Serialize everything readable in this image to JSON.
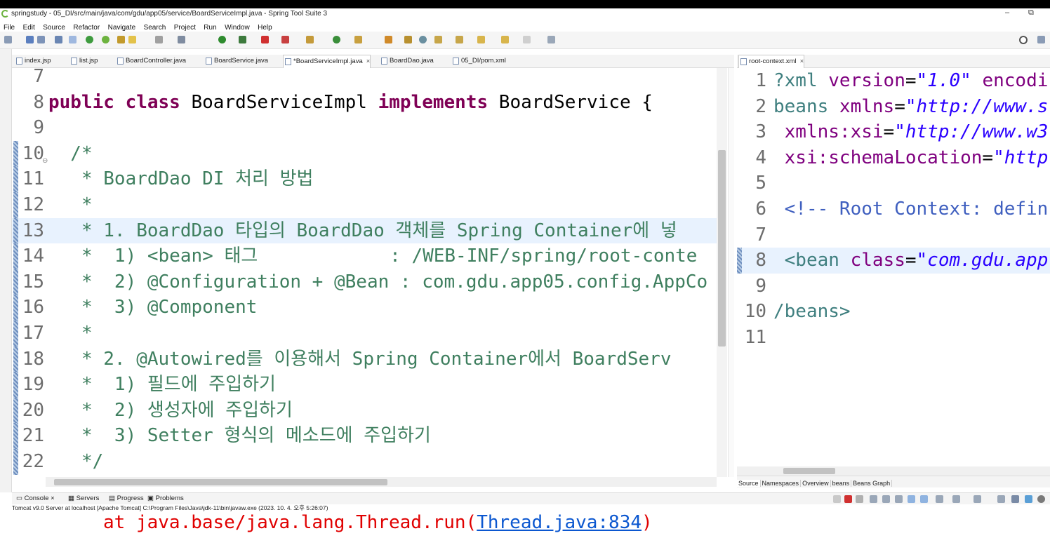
{
  "window": {
    "title": "springstudy - 05_DI/src/main/java/com/gdu/app05/service/BoardServiceImpl.java - Spring Tool Suite 3",
    "minimize": "–",
    "restore": "⧉"
  },
  "menu": [
    "File",
    "Edit",
    "Source",
    "Refactor",
    "Navigate",
    "Search",
    "Project",
    "Run",
    "Window",
    "Help"
  ],
  "editor_tabs": [
    {
      "label": "index.jsp"
    },
    {
      "label": "list.jsp"
    },
    {
      "label": "BoardController.java"
    },
    {
      "label": "BoardService.java"
    },
    {
      "label": "*BoardServiceImpl.java",
      "close": "×"
    },
    {
      "label": "BoardDao.java"
    },
    {
      "label": "05_DI/pom.xml"
    }
  ],
  "code_lines": [
    {
      "n": "7",
      "text": ""
    },
    {
      "n": "8",
      "kw1": "public class ",
      "mid": "BoardServiceImpl ",
      "kw2": "implements ",
      "rest": "BoardService {"
    },
    {
      "n": "9",
      "text": ""
    },
    {
      "n": "10",
      "text": "  /*"
    },
    {
      "n": "11",
      "text": "   * BoardDao DI 처리 방법"
    },
    {
      "n": "12",
      "text": "   *"
    },
    {
      "n": "13",
      "text": "   * 1. BoardDao 타입의 BoardDao 객체를 Spring Container에 넣"
    },
    {
      "n": "14",
      "text": "   *  1) <bean> 태그            : /WEB-INF/spring/root-conte"
    },
    {
      "n": "15",
      "text": "   *  2) @Configuration + @Bean : com.gdu.app05.config.AppCo"
    },
    {
      "n": "16",
      "text": "   *  3) @Component"
    },
    {
      "n": "17",
      "text": "   *"
    },
    {
      "n": "18",
      "text": "   * 2. @Autowired를 이용해서 Spring Container에서 BoardServ"
    },
    {
      "n": "19",
      "text": "   *  1) 필드에 주입하기"
    },
    {
      "n": "20",
      "text": "   *  2) 생성자에 주입하기"
    },
    {
      "n": "21",
      "text": "   *  3) Setter 형식의 메소드에 주입하기"
    },
    {
      "n": "22",
      "text": "   */"
    }
  ],
  "xml_tab": {
    "label": "root-context.xml",
    "close": "×"
  },
  "xml_lines": [
    {
      "n": "1",
      "a": "?xml ",
      "b": "version",
      "c": "=",
      "d": "\"1.0\"",
      "e": " encodi"
    },
    {
      "n": "2",
      "a": "beans ",
      "b": "xmlns",
      "c": "=",
      "d": "\"http://www.s",
      "e": ""
    },
    {
      "n": "3",
      "a": " ",
      "b": "xmlns:xsi",
      "c": "=",
      "d": "\"http://www.w3",
      "e": ""
    },
    {
      "n": "4",
      "a": " ",
      "b": "xsi:schemaLocation",
      "c": "=",
      "d": "\"http",
      "e": ""
    },
    {
      "n": "5",
      "a": "",
      "b": "",
      "c": "",
      "d": "",
      "e": ""
    },
    {
      "n": "6",
      "cm": " <!-- Root Context: defin"
    },
    {
      "n": "7",
      "a": "",
      "b": "",
      "c": "",
      "d": "",
      "e": ""
    },
    {
      "n": "8",
      "a": " <bean ",
      "b": "class",
      "c": "=",
      "d": "\"com.gdu.app",
      "e": ""
    },
    {
      "n": "9",
      "a": "",
      "b": "",
      "c": "",
      "d": "",
      "e": ""
    },
    {
      "n": "10",
      "a": "/beans>",
      "b": "",
      "c": "",
      "d": "",
      "e": ""
    },
    {
      "n": "11",
      "a": "",
      "b": "",
      "c": "",
      "d": "",
      "e": ""
    }
  ],
  "xml_bottom_tabs": [
    "Source",
    "Namespaces",
    "Overview",
    "beans",
    "Beans Graph"
  ],
  "console": {
    "tabs": [
      {
        "label": "Console",
        "close": "×"
      },
      {
        "label": "Servers"
      },
      {
        "label": "Progress"
      },
      {
        "label": "Problems"
      }
    ],
    "info": "Tomcat v9.0 Server at localhost [Apache Tomcat] C:\\Program Files\\Java\\jdk-11\\bin\\javaw.exe  (2023. 10. 4. 오후 5:26:07)",
    "out_prefix": "at java.base/java.lang.Thread.run(",
    "out_link": "Thread.java:834",
    "out_suffix": ")"
  },
  "colors": {
    "keyword": "#7f0055",
    "comment": "#3f7f5f",
    "xml_tag": "#3f7f7f",
    "xml_attr": "#7f007f",
    "xml_value": "#2a00ff",
    "current_line": "#e8f2fe",
    "console_error": "#e00000"
  }
}
